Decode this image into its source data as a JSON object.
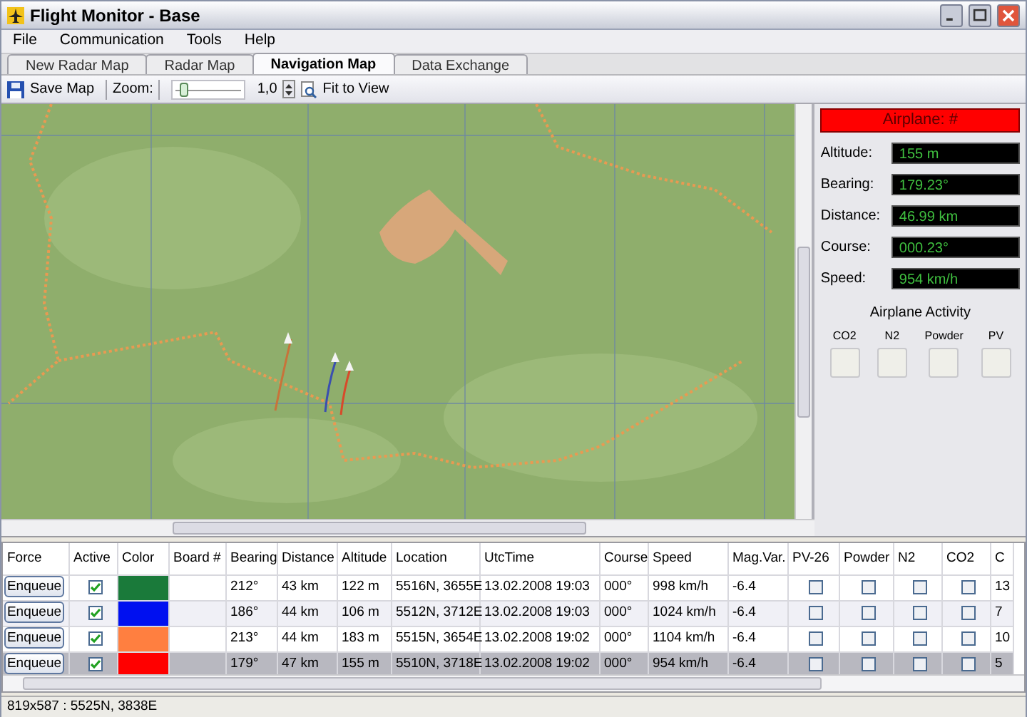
{
  "window": {
    "title": "Flight Monitor - Base"
  },
  "menu": [
    "File",
    "Communication",
    "Tools",
    "Help"
  ],
  "tabs": [
    {
      "label": "New Radar Map",
      "selected": false
    },
    {
      "label": "Radar Map",
      "selected": false
    },
    {
      "label": "Navigation Map",
      "selected": true
    },
    {
      "label": "Data Exchange",
      "selected": false
    }
  ],
  "toolbar": {
    "save": "Save Map",
    "zoom_label": "Zoom:",
    "zoom_slider": {
      "level": 0.1
    },
    "zoom_value": "1,0",
    "fit": "Fit to View"
  },
  "airplane_panel": {
    "title": "Airplane: #",
    "fields": [
      {
        "label": "Altitude:",
        "value": "155 m"
      },
      {
        "label": "Bearing:",
        "value": "179.23°"
      },
      {
        "label": "Distance:",
        "value": "46.99 km"
      },
      {
        "label": "Course:",
        "value": "000.23°"
      },
      {
        "label": "Speed:",
        "value": "954 km/h"
      }
    ],
    "activity_title": "Airplane Activity",
    "activity": [
      {
        "label": "CO2",
        "on": false
      },
      {
        "label": "N2",
        "on": false
      },
      {
        "label": "Powder",
        "on": false
      },
      {
        "label": "PV",
        "on": false
      }
    ]
  },
  "table": {
    "columns": [
      "Force",
      "Active",
      "Color",
      "Board #",
      "Bearing",
      "Distance",
      "Altitude",
      "Location",
      "UtcTime",
      "Course",
      "Speed",
      "Mag.Var.",
      "PV-26",
      "Powder",
      "N2",
      "CO2",
      "C"
    ],
    "rows": [
      {
        "force": "Enqueue",
        "active": true,
        "color": "#1a7a3a",
        "board": "",
        "bearing": "212°",
        "distance": "43 km",
        "altitude": "122 m",
        "location": "5516N, 3655E",
        "utc": "13.02.2008 19:03",
        "course": "000°",
        "speed": "998 km/h",
        "magvar": "-6.4",
        "pv26": false,
        "powder": false,
        "n2": false,
        "co2": false,
        "column_17": "13",
        "selected": false
      },
      {
        "force": "Enqueue",
        "active": true,
        "color": "#0010f0",
        "board": "",
        "bearing": "186°",
        "distance": "44 km",
        "altitude": "106 m",
        "location": "5512N, 3712E",
        "utc": "13.02.2008 19:03",
        "course": "000°",
        "speed": "1024 km/h",
        "magvar": "-6.4",
        "pv26": false,
        "powder": false,
        "n2": false,
        "co2": false,
        "column_17": "7",
        "selected": false
      },
      {
        "force": "Enqueue",
        "active": true,
        "color": "#ff7f40",
        "board": "",
        "bearing": "213°",
        "distance": "44 km",
        "altitude": "183 m",
        "location": "5515N, 3654E",
        "utc": "13.02.2008 19:02",
        "course": "000°",
        "speed": "1104 km/h",
        "magvar": "-6.4",
        "pv26": false,
        "powder": false,
        "n2": false,
        "co2": false,
        "column_17": "10",
        "selected": false
      },
      {
        "force": "Enqueue",
        "active": true,
        "color": "#ff0000",
        "board": "",
        "bearing": "179°",
        "distance": "47 km",
        "altitude": "155 m",
        "location": "5510N, 3718E",
        "utc": "13.02.2008 19:02",
        "course": "000°",
        "speed": "954 km/h",
        "magvar": "-6.4",
        "pv26": false,
        "powder": false,
        "n2": false,
        "co2": false,
        "column_17": "5",
        "selected": true
      }
    ]
  },
  "status_bar": "819x587 : 5525N, 3838E"
}
